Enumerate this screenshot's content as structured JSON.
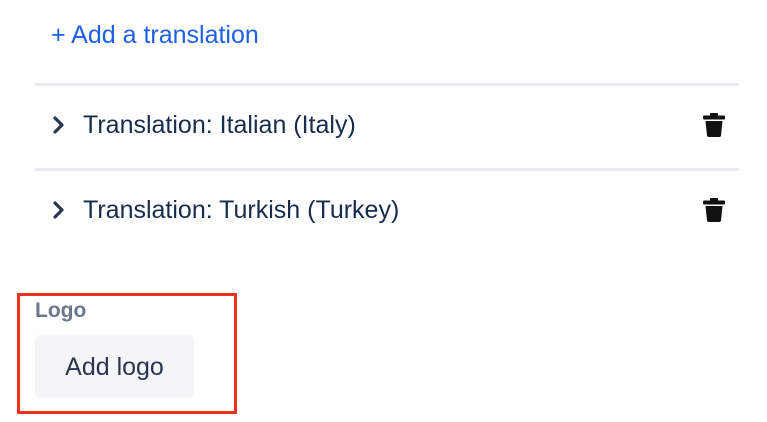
{
  "add_translation_link": "+ Add a translation",
  "translations": [
    {
      "label": "Translation: Italian (Italy)",
      "expand_icon": "chevron-right-icon",
      "delete_icon": "trash-icon"
    },
    {
      "label": "Translation: Turkish (Turkey)",
      "expand_icon": "chevron-right-icon",
      "delete_icon": "trash-icon"
    }
  ],
  "logo_section": {
    "label": "Logo",
    "button_label": "Add logo"
  },
  "colors": {
    "link": "#1f5fe5",
    "highlight": "#ef3320",
    "text": "#172b4d",
    "muted_label": "#6b778c",
    "button_bg": "#f4f5f7",
    "divider": "#e9ebee"
  }
}
